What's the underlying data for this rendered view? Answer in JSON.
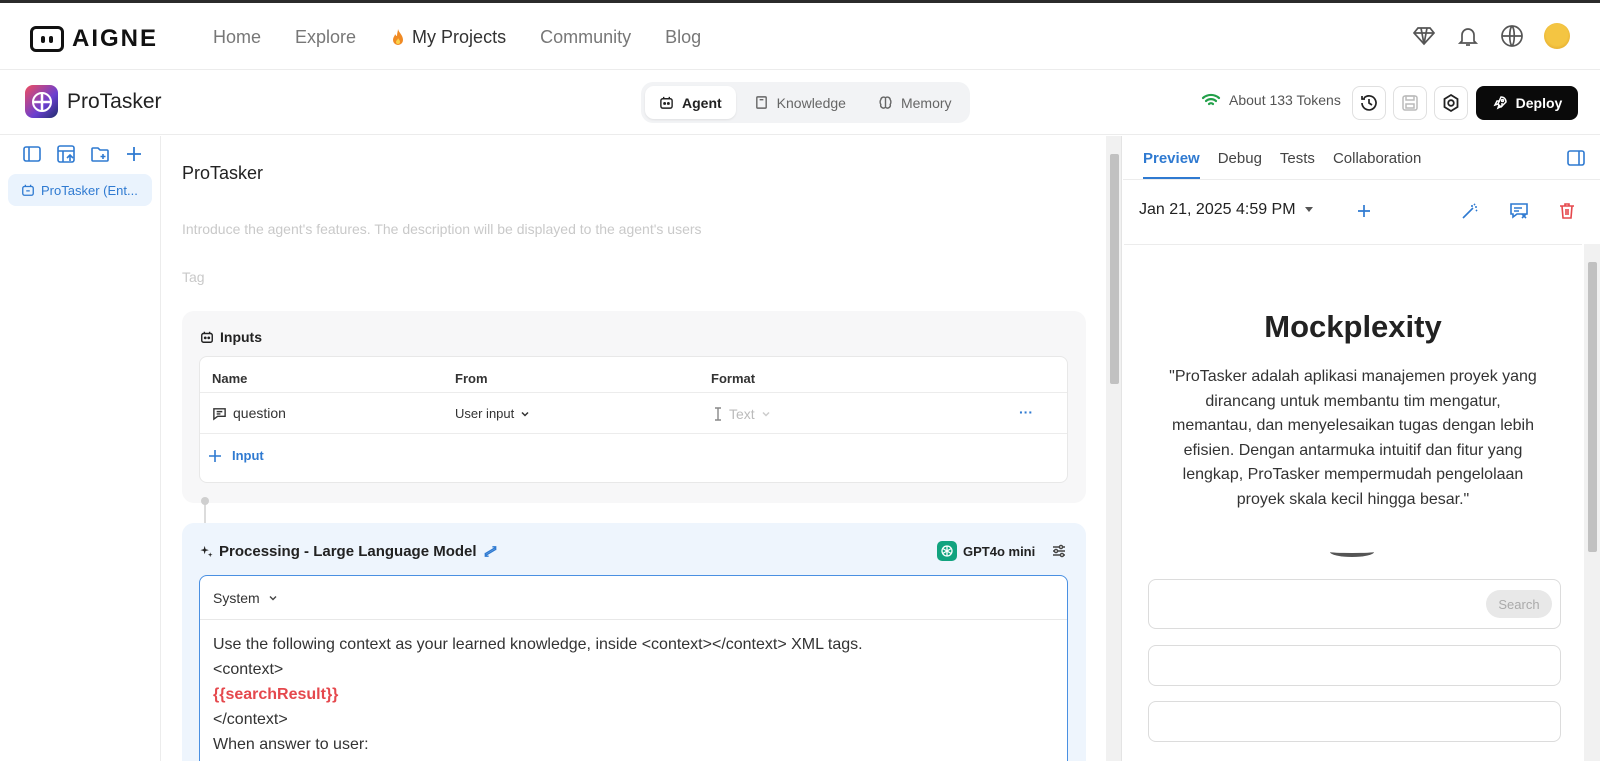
{
  "header": {
    "logo_text": "AIGNE",
    "nav": [
      "Home",
      "Explore",
      "My Projects",
      "Community",
      "Blog"
    ]
  },
  "subheader": {
    "app_name": "ProTasker",
    "tabs": [
      "Agent",
      "Knowledge",
      "Memory"
    ],
    "tokens": "About 133 Tokens",
    "deploy": "Deploy"
  },
  "sidebar": {
    "item": "ProTasker (Ent..."
  },
  "main": {
    "title": "ProTasker",
    "description_placeholder": "Introduce the agent's features. The description will be displayed to the agent's users",
    "tag_placeholder": "Tag",
    "inputs": {
      "heading": "Inputs",
      "columns": [
        "Name",
        "From",
        "Format"
      ],
      "row": {
        "name": "question",
        "from": "User input",
        "format": "Text",
        "more": "···"
      },
      "add_label": "Input"
    },
    "processing": {
      "heading": "Processing -  Large Language Model",
      "model": "GPT4o mini",
      "role": "System",
      "lines": [
        "Use the following context as your learned knowledge, inside <context></context> XML tags.",
        "<context>",
        "{{searchResult}}",
        "</context>",
        "When answer to user:"
      ]
    }
  },
  "right": {
    "tabs": [
      "Preview",
      "Debug",
      "Tests",
      "Collaboration"
    ],
    "session": "Jan 21, 2025 4:59 PM",
    "preview_title": "Mockplexity",
    "preview_desc": "\"ProTasker adalah aplikasi manajemen proyek yang dirancang untuk membantu tim mengatur, memantau, dan menyelesaikan tugas dengan lebih efisien. Dengan antarmuka intuitif dan fitur yang lengkap, ProTasker mempermudah pengelolaan proyek skala kecil hingga besar.\"",
    "search_button": "Search"
  },
  "colors": {
    "accent": "#2f7ad1",
    "deploy_bg": "#0a0a0a",
    "variable": "#e5484d",
    "wifi": "#23a04a"
  }
}
